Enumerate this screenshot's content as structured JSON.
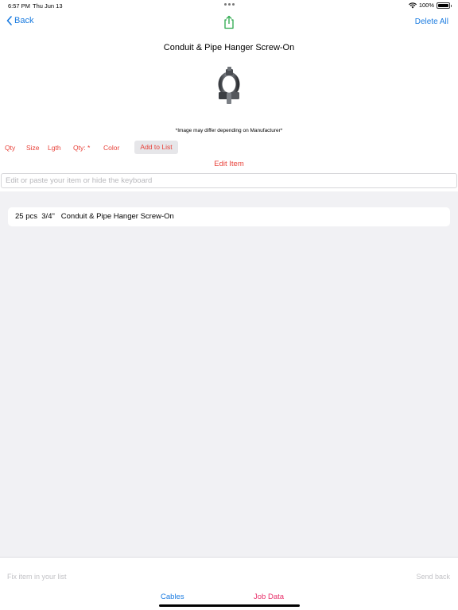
{
  "status_bar": {
    "time": "6:57 PM",
    "date": "Thu Jun 13",
    "battery": "100%"
  },
  "nav": {
    "back_label": "Back",
    "delete_all_label": "Delete All"
  },
  "item": {
    "title": "Conduit & Pipe Hanger Screw-On",
    "disclaimer": "*Image may differ depending on Manufacturer*"
  },
  "attributes": {
    "qty": "Qty",
    "size": "Size",
    "length": "Lgth",
    "qty_star": "Qty: *",
    "color": "Color",
    "add_to_list": "Add to List"
  },
  "edit": {
    "label": "Edit Item",
    "placeholder": "Edit or paste your item or hide the keyboard"
  },
  "list": {
    "items": [
      {
        "text": "25 pcs  3/4\"   Conduit & Pipe Hanger Screw-On"
      }
    ]
  },
  "bottom": {
    "fix_placeholder": "Fix item in your list",
    "send_back": "Send back",
    "tab_cables": "Cables",
    "tab_job_data": "Job Data"
  },
  "colors": {
    "accent_blue": "#1a7be0",
    "accent_red": "#e8423a",
    "accent_pink": "#e8306a",
    "share_green": "#2aa84a"
  },
  "icons": [
    "back-chevron-icon",
    "share-icon",
    "wifi-icon",
    "battery-icon",
    "pipe-hanger-image"
  ]
}
